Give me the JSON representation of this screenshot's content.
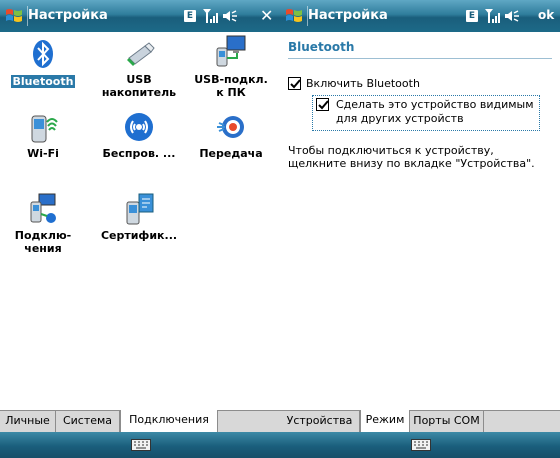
{
  "left": {
    "title": "Настройка",
    "status_badge": "E",
    "icons": [
      {
        "label": "Bluetooth",
        "name": "bluetooth"
      },
      {
        "label": "USB\nнакопитель",
        "name": "usb-storage"
      },
      {
        "label": "USB-подкл.\nк ПК",
        "name": "usb-pc"
      },
      {
        "label": "Wi-Fi",
        "name": "wifi"
      },
      {
        "label": "Беспров. ...",
        "name": "wireless"
      },
      {
        "label": "Передача",
        "name": "beam"
      },
      {
        "label": "Подклю-\nчения",
        "name": "connections"
      },
      {
        "label": "Сертифик...",
        "name": "certificates"
      }
    ],
    "tabs": [
      "Личные",
      "Система",
      "Подключения"
    ],
    "active_tab": "Подключения"
  },
  "right": {
    "title": "Настройка",
    "status_badge": "E",
    "ok_label": "ok",
    "section_title": "Bluetooth",
    "enable_bt_label": "Включить Bluetooth",
    "enable_bt_checked": true,
    "visible_label_1": "Сделать это устройство видимым",
    "visible_label_2": "для других устройств",
    "visible_checked": true,
    "info_line_1": "Чтобы подключиться к устройству,",
    "info_line_2": "щелкните внизу по вкладке \"Устройства\".",
    "tabs": [
      "Устройства",
      "Режим",
      "Порты COM"
    ],
    "active_tab": "Режим"
  },
  "colors": {
    "titlebar": "#1a5e7c",
    "accent": "#2a79a8",
    "tabbar": "#d8d8d8"
  }
}
